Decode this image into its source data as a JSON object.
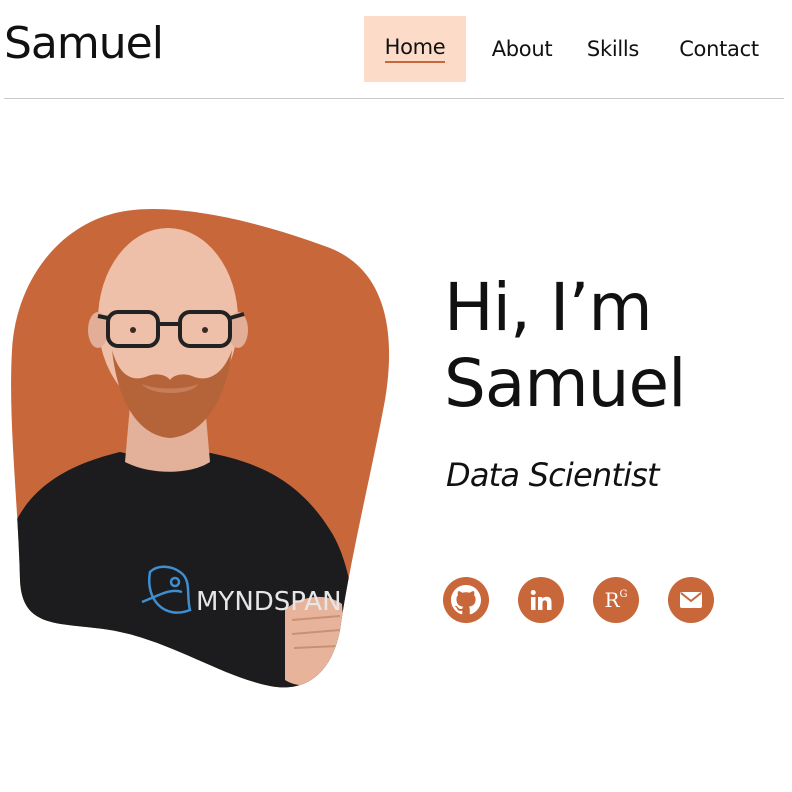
{
  "header": {
    "logo": "Samuel",
    "nav": [
      {
        "label": "Home",
        "active": true
      },
      {
        "label": "About",
        "active": false
      },
      {
        "label": "Skills",
        "active": false
      },
      {
        "label": "Contact",
        "active": false
      }
    ]
  },
  "hero": {
    "greeting_line1": "Hi, I’m",
    "greeting_line2": "Samuel",
    "role": "Data Scientist",
    "shirt_text": "MYNDSPAN",
    "social": [
      {
        "icon": "github-icon"
      },
      {
        "icon": "linkedin-icon"
      },
      {
        "icon": "researchgate-icon",
        "text": "R",
        "sup": "G"
      },
      {
        "icon": "mail-icon"
      }
    ]
  },
  "colors": {
    "accent": "#c8673a",
    "nav_active_bg": "#fcdcc8",
    "text": "#111111"
  }
}
